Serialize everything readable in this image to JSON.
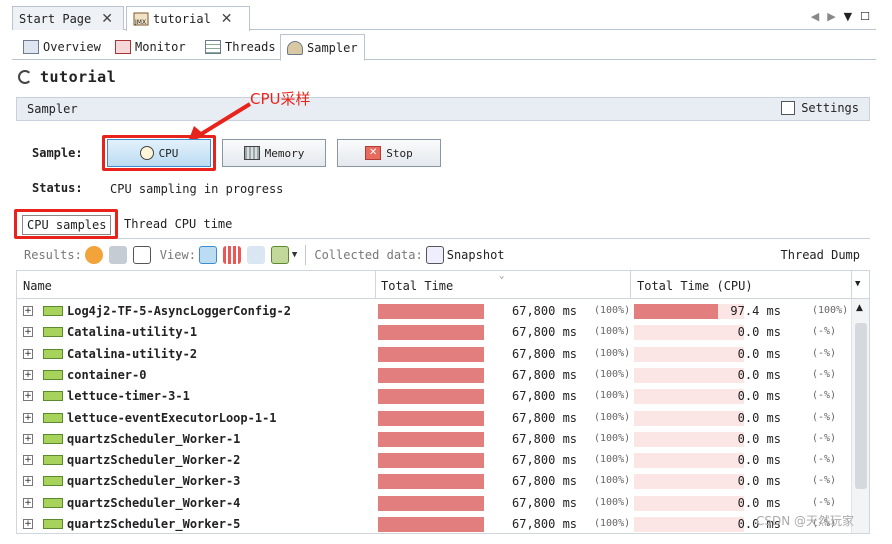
{
  "doc_tabs": [
    {
      "label": "Start Page"
    },
    {
      "label": "tutorial"
    }
  ],
  "sub_tabs": [
    {
      "label": "Overview"
    },
    {
      "label": "Monitor"
    },
    {
      "label": "Threads"
    },
    {
      "label": "Sampler"
    }
  ],
  "app_title": "tutorial",
  "sampler_header": "Sampler",
  "settings_label": "Settings",
  "annotation": "CPU采样",
  "sample_label": "Sample:",
  "buttons": {
    "cpu": "CPU",
    "memory": "Memory",
    "stop": "Stop"
  },
  "status_label": "Status:",
  "status_value": "CPU sampling in progress",
  "view_tabs": {
    "cpu_samples": "CPU samples",
    "thread_cpu_time": "Thread CPU time"
  },
  "toolbar": {
    "results_label": "Results:",
    "view_label": "View:",
    "collected_label": "Collected data:",
    "snapshot_label": "Snapshot",
    "thread_dump_label": "Thread Dump"
  },
  "table": {
    "columns": [
      "Name",
      "Total Time",
      "Total Time (CPU)"
    ],
    "rows": [
      {
        "name": "Log4j2-TF-5-AsyncLoggerConfig-2",
        "total": "67,800 ms",
        "total_pct": "(100%)",
        "cpu": "97.4 ms",
        "cpu_pct": "(100%)",
        "total_frac": 1.0,
        "cpu_frac": 1.0
      },
      {
        "name": "Catalina-utility-1",
        "total": "67,800 ms",
        "total_pct": "(100%)",
        "cpu": "0.0 ms",
        "cpu_pct": "(-%)",
        "total_frac": 1.0,
        "cpu_frac": 0
      },
      {
        "name": "Catalina-utility-2",
        "total": "67,800 ms",
        "total_pct": "(100%)",
        "cpu": "0.0 ms",
        "cpu_pct": "(-%)",
        "total_frac": 1.0,
        "cpu_frac": 0
      },
      {
        "name": "container-0",
        "total": "67,800 ms",
        "total_pct": "(100%)",
        "cpu": "0.0 ms",
        "cpu_pct": "(-%)",
        "total_frac": 1.0,
        "cpu_frac": 0
      },
      {
        "name": "lettuce-timer-3-1",
        "total": "67,800 ms",
        "total_pct": "(100%)",
        "cpu": "0.0 ms",
        "cpu_pct": "(-%)",
        "total_frac": 1.0,
        "cpu_frac": 0
      },
      {
        "name": "lettuce-eventExecutorLoop-1-1",
        "total": "67,800 ms",
        "total_pct": "(100%)",
        "cpu": "0.0 ms",
        "cpu_pct": "(-%)",
        "total_frac": 1.0,
        "cpu_frac": 0
      },
      {
        "name": "quartzScheduler_Worker-1",
        "total": "67,800 ms",
        "total_pct": "(100%)",
        "cpu": "0.0 ms",
        "cpu_pct": "(-%)",
        "total_frac": 1.0,
        "cpu_frac": 0
      },
      {
        "name": "quartzScheduler_Worker-2",
        "total": "67,800 ms",
        "total_pct": "(100%)",
        "cpu": "0.0 ms",
        "cpu_pct": "(-%)",
        "total_frac": 1.0,
        "cpu_frac": 0
      },
      {
        "name": "quartzScheduler_Worker-3",
        "total": "67,800 ms",
        "total_pct": "(100%)",
        "cpu": "0.0 ms",
        "cpu_pct": "(-%)",
        "total_frac": 1.0,
        "cpu_frac": 0
      },
      {
        "name": "quartzScheduler_Worker-4",
        "total": "67,800 ms",
        "total_pct": "(100%)",
        "cpu": "0.0 ms",
        "cpu_pct": "(-%)",
        "total_frac": 1.0,
        "cpu_frac": 0
      },
      {
        "name": "quartzScheduler_Worker-5",
        "total": "67,800 ms",
        "total_pct": "(100%)",
        "cpu": "0.0 ms",
        "cpu_pct": "(-%)",
        "total_frac": 1.0,
        "cpu_frac": 0
      }
    ]
  },
  "watermark": "CSDN @天然玩家",
  "colors": {
    "accent": "#e8231b",
    "bar": "#e37e7e",
    "bar_bg": "#fbe5e5",
    "active_button": "#bcdcf3"
  }
}
